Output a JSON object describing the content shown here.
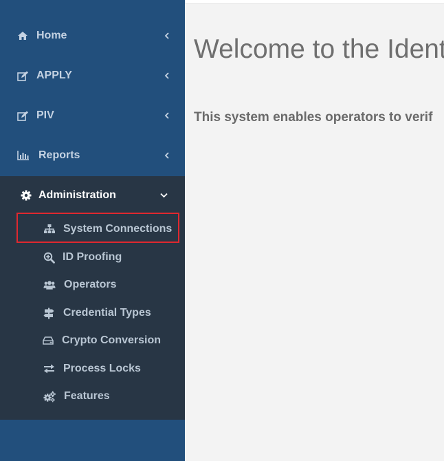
{
  "sidebar": {
    "items": [
      {
        "label": "Home",
        "icon": "home-icon"
      },
      {
        "label": "APPLY",
        "icon": "edit-icon"
      },
      {
        "label": "PIV",
        "icon": "edit-icon"
      },
      {
        "label": "Reports",
        "icon": "bar-chart-icon"
      },
      {
        "label": "Administration",
        "icon": "gear-icon",
        "expanded": true
      }
    ],
    "admin_children": [
      {
        "label": "System Connections",
        "icon": "sitemap-icon",
        "selected": true
      },
      {
        "label": "ID Proofing",
        "icon": "search-plus-icon"
      },
      {
        "label": "Operators",
        "icon": "users-icon"
      },
      {
        "label": "Credential Types",
        "icon": "signpost-icon"
      },
      {
        "label": "Crypto Conversion",
        "icon": "drive-icon"
      },
      {
        "label": "Process Locks",
        "icon": "exchange-icon"
      },
      {
        "label": "Features",
        "icon": "gears-icon"
      }
    ]
  },
  "main": {
    "title": "Welcome to the Ident",
    "description": "This system enables operators to verif"
  },
  "colors": {
    "sidebar_bg": "#224f7c",
    "admin_bg": "#283645",
    "highlight_border": "#e0282f",
    "content_bg": "#f3f3f3"
  }
}
